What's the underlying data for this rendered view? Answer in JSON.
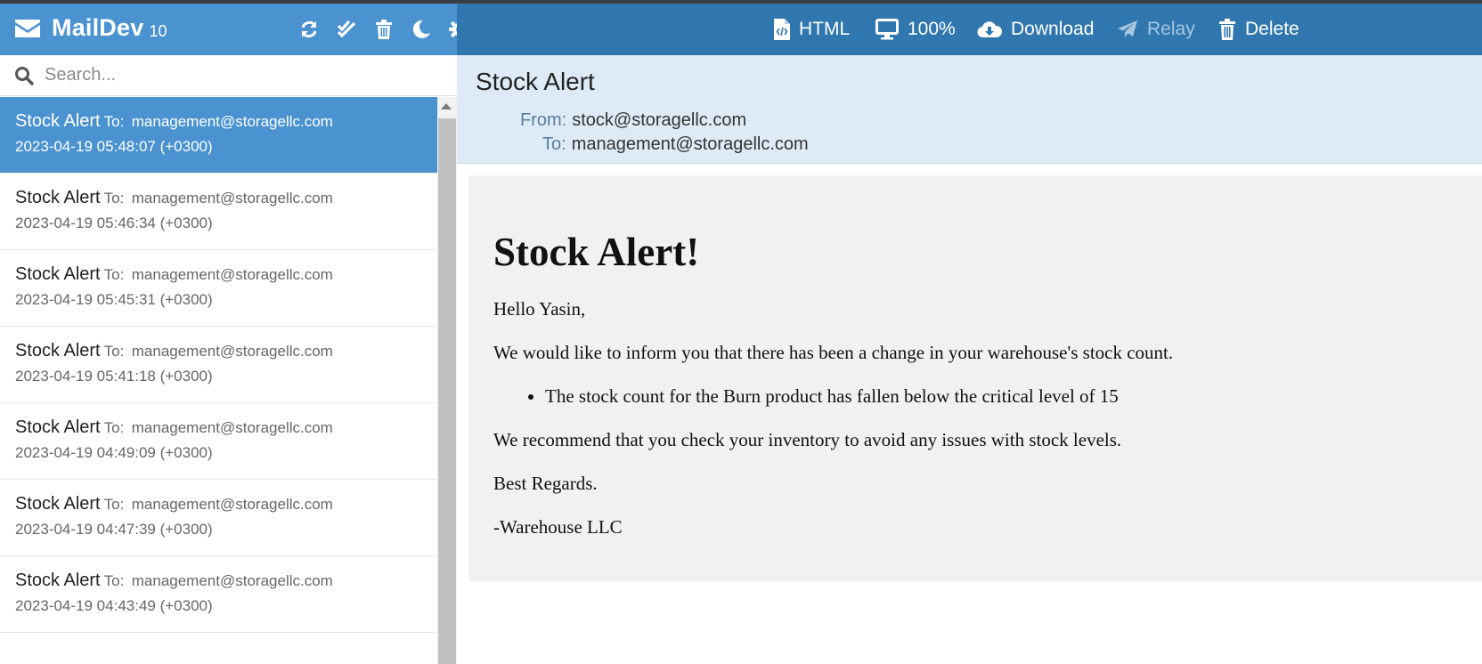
{
  "app": {
    "name": "MailDev",
    "count": "10"
  },
  "sidebar_tools": [
    "refresh-icon",
    "mark-read-icon",
    "trash-icon",
    "moon-icon",
    "gear-icon"
  ],
  "search": {
    "placeholder": "Search..."
  },
  "emails": [
    {
      "subject": "Stock Alert",
      "to_label": "To:",
      "to": "management@storagellc.com",
      "date": "2023-04-19 05:48:07 (+0300)",
      "selected": true
    },
    {
      "subject": "Stock Alert",
      "to_label": "To:",
      "to": "management@storagellc.com",
      "date": "2023-04-19 05:46:34 (+0300)"
    },
    {
      "subject": "Stock Alert",
      "to_label": "To:",
      "to": "management@storagellc.com",
      "date": "2023-04-19 05:45:31 (+0300)"
    },
    {
      "subject": "Stock Alert",
      "to_label": "To:",
      "to": "management@storagellc.com",
      "date": "2023-04-19 05:41:18 (+0300)"
    },
    {
      "subject": "Stock Alert",
      "to_label": "To:",
      "to": "management@storagellc.com",
      "date": "2023-04-19 04:49:09 (+0300)"
    },
    {
      "subject": "Stock Alert",
      "to_label": "To:",
      "to": "management@storagellc.com",
      "date": "2023-04-19 04:47:39 (+0300)"
    },
    {
      "subject": "Stock Alert",
      "to_label": "To:",
      "to": "management@storagellc.com",
      "date": "2023-04-19 04:43:49 (+0300)"
    }
  ],
  "toolbar": {
    "html_label": "HTML",
    "zoom_label": "100%",
    "download_label": "Download",
    "relay_label": "Relay",
    "delete_label": "Delete"
  },
  "message": {
    "subject": "Stock Alert",
    "from_label": "From:",
    "from": "stock@storagellc.com",
    "to_label": "To:",
    "to": "management@storagellc.com",
    "body": {
      "heading": "Stock Alert!",
      "greeting": "Hello Yasin,",
      "intro": "We would like to inform you that there has been a change in your warehouse's stock count.",
      "bullet": "The stock count for the Burn product has fallen below the critical level of 15",
      "recommendation": "We recommend that you check your inventory to avoid any issues with stock levels.",
      "closing": "Best Regards.",
      "signature": "-Warehouse LLC"
    }
  },
  "colors": {
    "brand_bar": "#4a93d0",
    "toolbar": "#2f77ae",
    "selected_item": "#4a93d0",
    "header_bg": "#deebf6",
    "body_bg": "#f1f1f1"
  }
}
